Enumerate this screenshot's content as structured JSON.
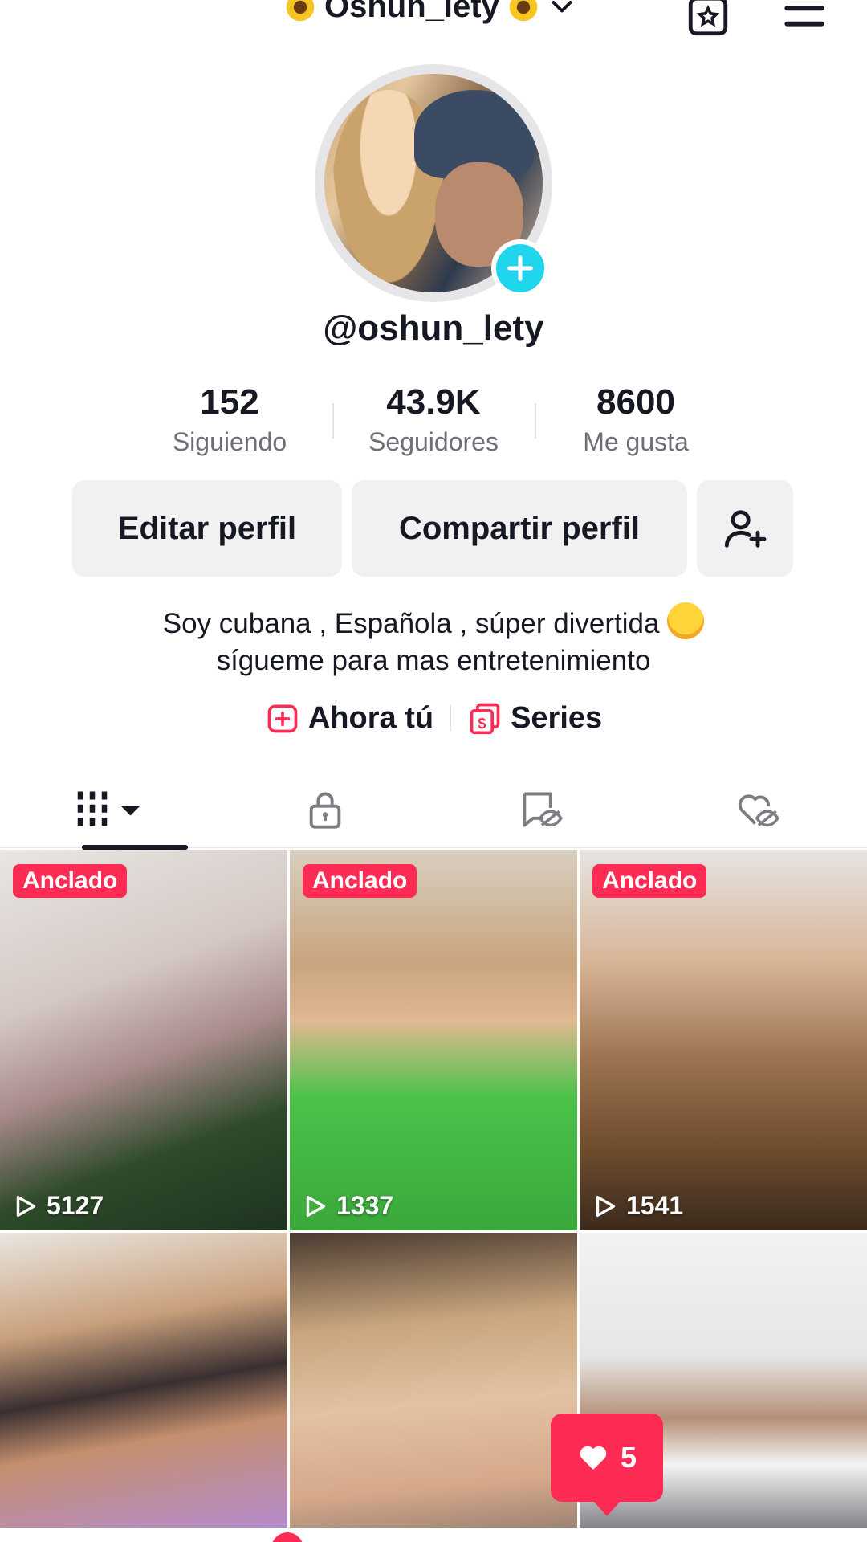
{
  "header": {
    "title": "Oshun_lety"
  },
  "profile": {
    "handle": "@oshun_lety",
    "stats": [
      {
        "value": "152",
        "label": "Siguiendo"
      },
      {
        "value": "43.9K",
        "label": "Seguidores"
      },
      {
        "value": "8600",
        "label": "Me gusta"
      }
    ],
    "buttons": {
      "edit": "Editar perfil",
      "share": "Compartir perfil"
    },
    "bio": {
      "line1": "Soy cubana , Española , súper divertida",
      "line2": "sígueme para mas entretenimiento"
    },
    "links": [
      {
        "label": "Ahora tú",
        "icon": "plus-square-icon"
      },
      {
        "label": "Series",
        "icon": "series-icon"
      }
    ]
  },
  "tabs": [
    {
      "name": "videos",
      "icon": "grid-icon"
    },
    {
      "name": "private",
      "icon": "lock-icon"
    },
    {
      "name": "favorites",
      "icon": "bookmark-hidden-icon"
    },
    {
      "name": "liked",
      "icon": "heart-hidden-icon"
    }
  ],
  "videos": [
    {
      "pinned": "Anclado",
      "views": "5127",
      "theme": "tree"
    },
    {
      "pinned": "Anclado",
      "views": "1337",
      "theme": "green"
    },
    {
      "pinned": "Anclado",
      "views": "1541",
      "theme": "leopard"
    },
    {
      "pinned": "",
      "views": "",
      "theme": "sunglasses"
    },
    {
      "pinned": "",
      "views": "",
      "theme": "glasses"
    },
    {
      "pinned": "",
      "views": "",
      "theme": "mirror"
    }
  ],
  "toast": {
    "count": "5"
  },
  "colors": {
    "accent": "#fe2c55",
    "badge": "#20d5ec",
    "text": "#161823",
    "muted": "#6e6f76"
  }
}
